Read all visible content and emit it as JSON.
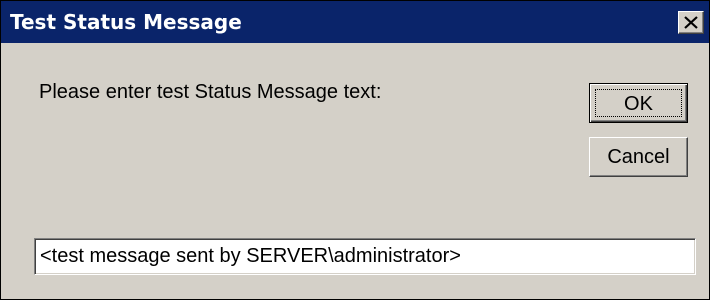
{
  "window": {
    "title": "Test Status Message",
    "close_icon": "close-icon"
  },
  "dialog": {
    "prompt": "Please enter test Status Message text:",
    "ok_label": "OK",
    "cancel_label": "Cancel",
    "message_value": "<test message sent by SERVER\\administrator>"
  },
  "colors": {
    "titlebar": "#0a246a",
    "face": "#d4d0c8",
    "title_text": "#ffffff"
  }
}
